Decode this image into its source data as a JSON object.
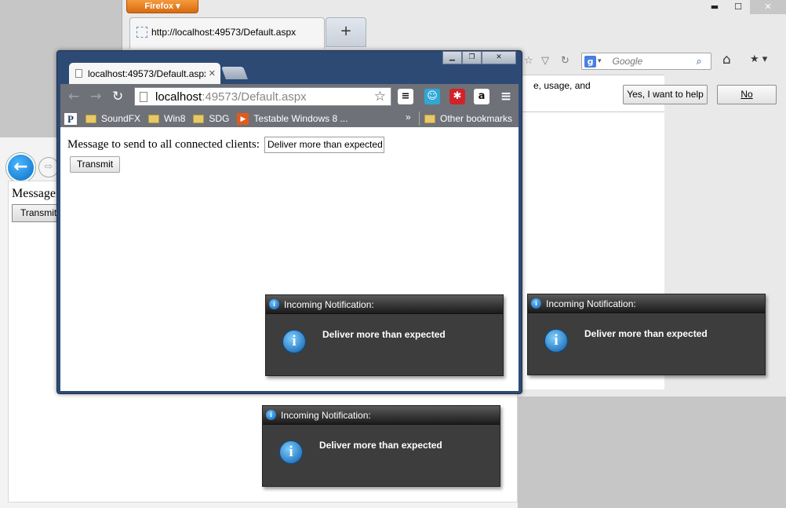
{
  "firefox": {
    "menu_label": "Firefox ▾",
    "controls": {
      "minimize": "▬",
      "maximize": "☐",
      "close": "✕"
    },
    "tab_title": "http://localhost:49573/Default.aspx",
    "new_tab_label": "+",
    "nav_glyphs": {
      "bookmark_star": "☆",
      "dropdown": "▽",
      "reload": "↻"
    },
    "search": {
      "engine_glyph": "g",
      "dropdown": "▾",
      "placeholder": "Google",
      "search_glyph": "⌕"
    },
    "home_glyph": "⌂",
    "bookmarks_glyph": "★ ▾",
    "notification": {
      "text": "e, usage, and",
      "yes_label": "Yes, I want to help",
      "no_label": "No"
    }
  },
  "ie": {
    "back_glyph": "←",
    "forward_glyph": "⇨",
    "label_partial": "Message",
    "transmit_partial": "Transmit"
  },
  "chrome": {
    "controls": {
      "minimize": "▁",
      "restore": "❐",
      "close": "✕"
    },
    "tab_title": "localhost:49573/Default.aspx",
    "tab_close": "✕",
    "nav": {
      "back": "←",
      "forward": "→",
      "reload": "↻"
    },
    "url_host": "localhost",
    "url_rest": ":49573/Default.aspx",
    "star_glyph": "☆",
    "extensions": {
      "buffer": "≡",
      "cam": "☺",
      "lastpass": "✱",
      "amazon": "a",
      "menu": "≡"
    },
    "bookmarks": {
      "pinboard": "P",
      "items": [
        "SoundFX",
        "Win8",
        "SDG"
      ],
      "testable_icon": "▶",
      "testable": "Testable Windows 8 ...",
      "more": "»",
      "other": "Other bookmarks"
    },
    "page": {
      "label": "Message to send to all connected clients:",
      "input_value": "Deliver more than expected",
      "transmit_label": "Transmit"
    }
  },
  "notifications": [
    {
      "title": "Incoming Notification:",
      "message": "Deliver more than expected"
    },
    {
      "title": "Incoming Notification:",
      "message": "Deliver more than expected"
    },
    {
      "title": "Incoming Notification:",
      "message": "Deliver more than expected"
    }
  ],
  "icon_glyph": "i"
}
